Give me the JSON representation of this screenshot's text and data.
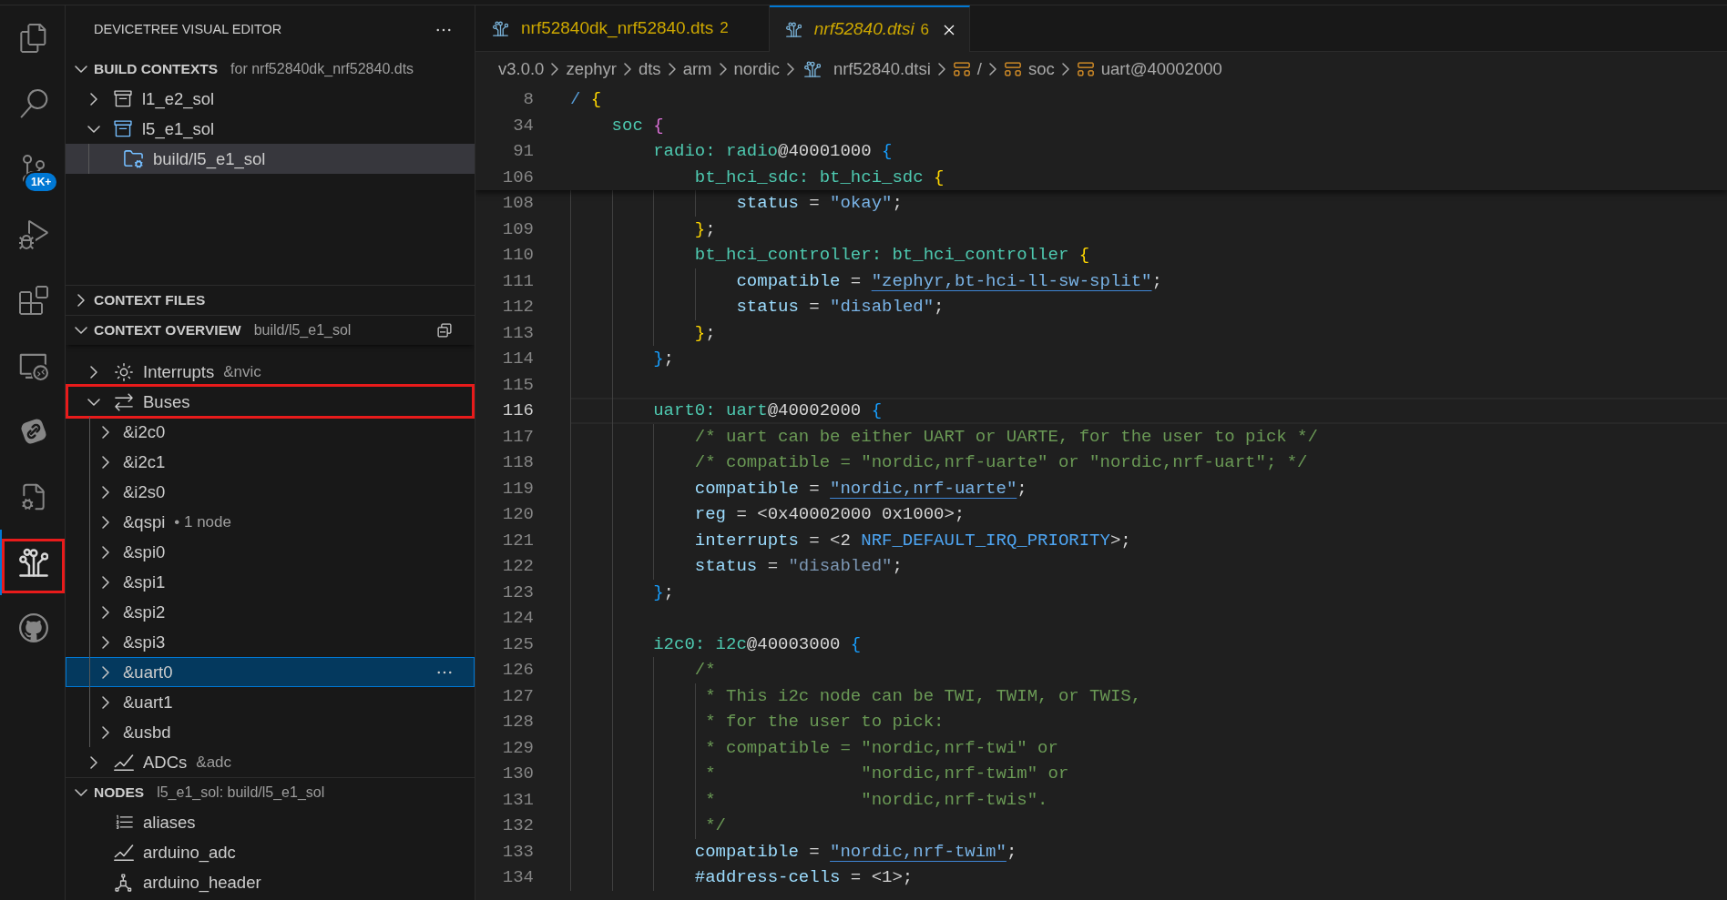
{
  "activity_bar": {
    "items": [
      {
        "kind": "explorer",
        "selected": false,
        "annotated": false
      },
      {
        "kind": "search",
        "selected": false,
        "annotated": false
      },
      {
        "kind": "scm",
        "badge": "1K+",
        "selected": false,
        "annotated": false
      },
      {
        "kind": "debug",
        "selected": false,
        "annotated": false
      },
      {
        "kind": "extensions",
        "selected": false,
        "annotated": false
      },
      {
        "kind": "remote",
        "selected": false,
        "annotated": false
      },
      {
        "kind": "link",
        "selected": false,
        "annotated": false
      },
      {
        "kind": "cpp",
        "selected": false,
        "annotated": false
      },
      {
        "kind": "devicetree",
        "selected": true,
        "annotated": true
      },
      {
        "kind": "github",
        "selected": false,
        "annotated": false
      }
    ]
  },
  "sidebar": {
    "title": "DEVICETREE VISUAL EDITOR",
    "sections": [
      {
        "title": "BUILD CONTEXTS",
        "description": "for nrf52840dk_nrf52840.dts",
        "expanded": true,
        "focused": false,
        "items": [
          {
            "label": "l1_e2_sol",
            "expanded": false,
            "active": false,
            "selected": false
          },
          {
            "label": "l5_e1_sol",
            "expanded": true,
            "active": true,
            "selected": false,
            "children": [
              {
                "label": "build/l5_e1_sol",
                "selected": true
              }
            ]
          }
        ]
      },
      {
        "title": "CONTEXT FILES",
        "expanded": false
      },
      {
        "title": "CONTEXT OVERVIEW",
        "description": "build/l5_e1_sol",
        "expanded": true,
        "focused": true,
        "items": [
          {
            "kind": "interrupt",
            "label": "Interrupts",
            "description": "&nvic",
            "expanded": false,
            "selected": false,
            "annotated": false
          },
          {
            "kind": "bus",
            "label": "Buses",
            "expanded": true,
            "selected": false,
            "annotated": true,
            "children": [
              {
                "label": "&i2c0",
                "expanded": false,
                "selected": false
              },
              {
                "label": "&i2c1",
                "expanded": false,
                "selected": false
              },
              {
                "label": "&i2s0",
                "expanded": false,
                "selected": false
              },
              {
                "label": "&qspi",
                "description": "• 1 node",
                "expanded": false,
                "selected": false
              },
              {
                "label": "&spi0",
                "expanded": false,
                "selected": false
              },
              {
                "label": "&spi1",
                "expanded": false,
                "selected": false
              },
              {
                "label": "&spi2",
                "expanded": false,
                "selected": false
              },
              {
                "label": "&spi3",
                "expanded": false,
                "selected": false
              },
              {
                "label": "&uart0",
                "expanded": false,
                "selected": true
              },
              {
                "label": "&uart1",
                "expanded": false,
                "selected": false
              },
              {
                "label": "&usbd",
                "expanded": false,
                "selected": false
              }
            ]
          },
          {
            "kind": "adc",
            "label": "ADCs",
            "description": "&adc",
            "expanded": false,
            "selected": false,
            "annotated": false
          }
        ]
      },
      {
        "title": "NODES",
        "description": "l5_e1_sol: build/l5_e1_sol",
        "expanded": true,
        "focused": false,
        "items": [
          {
            "kind": "alias",
            "label": "aliases",
            "selected": false
          },
          {
            "kind": "adc",
            "label": "arduino_adc",
            "selected": false
          },
          {
            "kind": "connector",
            "label": "arduino_header",
            "selected": false
          }
        ]
      }
    ]
  },
  "editor": {
    "tabs": [
      {
        "label": "nrf52840dk_nrf52840.dts",
        "problems": "2",
        "selected": false,
        "preview": false
      },
      {
        "label": "nrf52840.dtsi",
        "problems": "6",
        "selected": true,
        "preview": true
      }
    ],
    "breadcrumbs": [
      {
        "label": "v3.0.0",
        "kind": "folder"
      },
      {
        "label": "zephyr",
        "kind": "folder"
      },
      {
        "label": "dts",
        "kind": "folder"
      },
      {
        "label": "arm",
        "kind": "folder"
      },
      {
        "label": "nordic",
        "kind": "folder"
      },
      {
        "label": "nrf52840.dtsi",
        "kind": "file"
      },
      {
        "label": "/",
        "kind": "node"
      },
      {
        "label": "soc",
        "kind": "node"
      },
      {
        "label": "uart@40002000",
        "kind": "node"
      }
    ],
    "sticky_lines": [
      {
        "number": "8",
        "tokens": [
          {
            "text": "/ ",
            "kind": "slash"
          },
          {
            "text": "{",
            "kind": "b1"
          }
        ]
      },
      {
        "number": "34",
        "tokens": [
          {
            "text": "    soc ",
            "kind": "name"
          },
          {
            "text": "{",
            "kind": "b2"
          }
        ]
      },
      {
        "number": "91",
        "tokens": [
          {
            "text": "        radio: radio",
            "kind": "name"
          },
          {
            "text": "@40001000 ",
            "kind": "plain"
          },
          {
            "text": "{",
            "kind": "b3"
          }
        ]
      },
      {
        "number": "106",
        "tokens": [
          {
            "text": "            bt_hci_sdc: bt_hci_sdc ",
            "kind": "name"
          },
          {
            "text": "{",
            "kind": "b1"
          }
        ]
      }
    ],
    "lines": [
      {
        "number": "108",
        "current": false,
        "tokens": [
          {
            "text": "                status",
            "kind": "prop"
          },
          {
            "text": " = ",
            "kind": "plain"
          },
          {
            "text": "\"okay\"",
            "kind": "str"
          },
          {
            "text": ";",
            "kind": "plain"
          }
        ]
      },
      {
        "number": "109",
        "current": false,
        "tokens": [
          {
            "text": "            }",
            "kind": "b1"
          },
          {
            "text": ";",
            "kind": "plain"
          }
        ]
      },
      {
        "number": "110",
        "current": false,
        "tokens": [
          {
            "text": "            bt_hci_controller: bt_hci_controller ",
            "kind": "name"
          },
          {
            "text": "{",
            "kind": "b1"
          }
        ]
      },
      {
        "number": "111",
        "current": false,
        "tokens": [
          {
            "text": "                compatible",
            "kind": "prop"
          },
          {
            "text": " = ",
            "kind": "plain"
          },
          {
            "text": "\"zephyr,bt-hci-ll-sw-split\"",
            "kind": "link"
          },
          {
            "text": ";",
            "kind": "plain"
          }
        ]
      },
      {
        "number": "112",
        "current": false,
        "tokens": [
          {
            "text": "                status",
            "kind": "prop"
          },
          {
            "text": " = ",
            "kind": "plain"
          },
          {
            "text": "\"disabled\"",
            "kind": "str"
          },
          {
            "text": ";",
            "kind": "plain"
          }
        ]
      },
      {
        "number": "113",
        "current": false,
        "tokens": [
          {
            "text": "            }",
            "kind": "b1"
          },
          {
            "text": ";",
            "kind": "plain"
          }
        ]
      },
      {
        "number": "114",
        "current": false,
        "tokens": [
          {
            "text": "        }",
            "kind": "b3"
          },
          {
            "text": ";",
            "kind": "plain"
          }
        ]
      },
      {
        "number": "115",
        "current": false
      },
      {
        "number": "116",
        "current": true,
        "tokens": [
          {
            "text": "        uart0: uart",
            "kind": "name"
          },
          {
            "text": "@40002000 ",
            "kind": "plain"
          },
          {
            "text": "{",
            "kind": "b3"
          }
        ]
      },
      {
        "number": "117",
        "current": false,
        "tokens": [
          {
            "text": "            /* uart can be either UART or UARTE, for the user to pick */",
            "kind": "comment"
          }
        ]
      },
      {
        "number": "118",
        "current": false,
        "tokens": [
          {
            "text": "            /* compatible = \"nordic,nrf-uarte\" or \"nordic,nrf-uart\"; */",
            "kind": "comment"
          }
        ]
      },
      {
        "number": "119",
        "current": false,
        "tokens": [
          {
            "text": "            compatible",
            "kind": "prop"
          },
          {
            "text": " = ",
            "kind": "plain"
          },
          {
            "text": "\"nordic,nrf-uarte\"",
            "kind": "link"
          },
          {
            "text": ";",
            "kind": "plain"
          }
        ]
      },
      {
        "number": "120",
        "current": false,
        "tokens": [
          {
            "text": "            reg",
            "kind": "prop"
          },
          {
            "text": " = <0x40002000 0x1000>;",
            "kind": "plain"
          }
        ]
      },
      {
        "number": "121",
        "current": false,
        "tokens": [
          {
            "text": "            interrupts",
            "kind": "prop"
          },
          {
            "text": " = <2 ",
            "kind": "plain"
          },
          {
            "text": "NRF_DEFAULT_IRQ_PRIORITY",
            "kind": "macro"
          },
          {
            "text": ">;",
            "kind": "plain"
          }
        ]
      },
      {
        "number": "122",
        "current": false,
        "tokens": [
          {
            "text": "            status",
            "kind": "prop"
          },
          {
            "text": " = ",
            "kind": "plain"
          },
          {
            "text": "\"disabled\"",
            "kind": "dim"
          },
          {
            "text": ";",
            "kind": "plain"
          }
        ]
      },
      {
        "number": "123",
        "current": false,
        "tokens": [
          {
            "text": "        }",
            "kind": "b3"
          },
          {
            "text": ";",
            "kind": "plain"
          }
        ]
      },
      {
        "number": "124",
        "current": false
      },
      {
        "number": "125",
        "current": false,
        "tokens": [
          {
            "text": "        i2c0: i2c",
            "kind": "name"
          },
          {
            "text": "@40003000 ",
            "kind": "plain"
          },
          {
            "text": "{",
            "kind": "b3"
          }
        ]
      },
      {
        "number": "126",
        "current": false,
        "tokens": [
          {
            "text": "            /*",
            "kind": "comment"
          }
        ]
      },
      {
        "number": "127",
        "current": false,
        "tokens": [
          {
            "text": "             * This i2c node can be TWI, TWIM, or TWIS,",
            "kind": "comment"
          }
        ]
      },
      {
        "number": "128",
        "current": false,
        "tokens": [
          {
            "text": "             * for the user to pick:",
            "kind": "comment"
          }
        ]
      },
      {
        "number": "129",
        "current": false,
        "tokens": [
          {
            "text": "             * compatible = \"nordic,nrf-twi\" or",
            "kind": "comment"
          }
        ]
      },
      {
        "number": "130",
        "current": false,
        "tokens": [
          {
            "text": "             *              \"nordic,nrf-twim\" or",
            "kind": "comment"
          }
        ]
      },
      {
        "number": "131",
        "current": false,
        "tokens": [
          {
            "text": "             *              \"nordic,nrf-twis\".",
            "kind": "comment"
          }
        ]
      },
      {
        "number": "132",
        "current": false,
        "tokens": [
          {
            "text": "             */",
            "kind": "comment"
          }
        ]
      },
      {
        "number": "133",
        "current": false,
        "tokens": [
          {
            "text": "            compatible",
            "kind": "prop"
          },
          {
            "text": " = ",
            "kind": "plain"
          },
          {
            "text": "\"nordic,nrf-twim\"",
            "kind": "link"
          },
          {
            "text": ";",
            "kind": "plain"
          }
        ]
      },
      {
        "number": "134",
        "current": false,
        "tokens": [
          {
            "text": "            #address-cells",
            "kind": "prop"
          },
          {
            "text": " = <1>;",
            "kind": "plain"
          }
        ]
      }
    ]
  }
}
